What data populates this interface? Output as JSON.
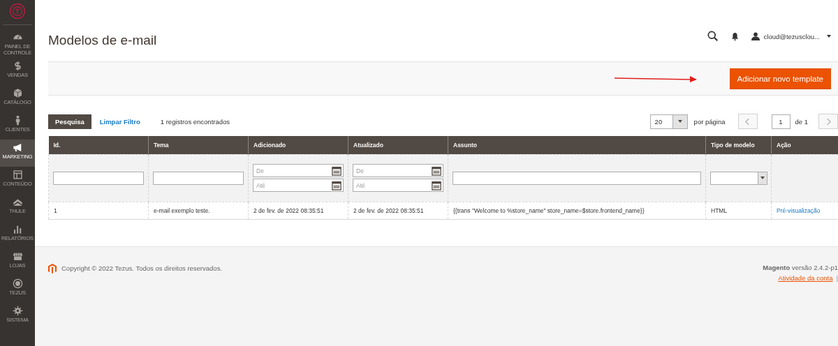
{
  "sidebar": {
    "items": [
      {
        "kind": "dashboard",
        "label": "PAINEL DE CONTROLE",
        "selected": false
      },
      {
        "kind": "dollar",
        "label": "VENDAS",
        "selected": false
      },
      {
        "kind": "box",
        "label": "CATÁLOGO",
        "selected": false
      },
      {
        "kind": "person",
        "label": "CLIENTES",
        "selected": false
      },
      {
        "kind": "megaphone",
        "label": "MARKETING",
        "selected": true
      },
      {
        "kind": "layout",
        "label": "CONTEÚDO",
        "selected": false
      },
      {
        "kind": "chevron",
        "label": "THULE",
        "selected": false
      },
      {
        "kind": "bars",
        "label": "RELATÓRIOS",
        "selected": false
      },
      {
        "kind": "store",
        "label": "LOJAS",
        "selected": false
      },
      {
        "kind": "badge",
        "label": "TEZUS",
        "selected": false
      },
      {
        "kind": "gear",
        "label": "SISTEMA",
        "selected": false
      }
    ]
  },
  "page": {
    "title": "Modelos de e-mail",
    "user": "cloud@tezusclou..."
  },
  "actions": {
    "add_button": "Adicionar novo template"
  },
  "toolbar": {
    "search_button": "Pesquisa",
    "clear_link": "Limpar Filtro",
    "records": "1 registros encontrados",
    "per_page": "20",
    "per_page_label": "por página",
    "page": "1",
    "page_total": "de 1"
  },
  "table": {
    "columns": [
      {
        "label": "Id.",
        "kind": "text"
      },
      {
        "label": "Tema",
        "kind": "text"
      },
      {
        "label": "Adicionado",
        "kind": "date",
        "from": "De",
        "to": "Até"
      },
      {
        "label": "Atualizado",
        "kind": "date",
        "from": "De",
        "to": "Até"
      },
      {
        "label": "Assunto",
        "kind": "text"
      },
      {
        "label": "Tipo de modelo",
        "kind": "select"
      },
      {
        "label": "Ação",
        "kind": "action"
      }
    ],
    "rows": [
      {
        "cells": [
          "1",
          "e-mail exemplo teste.",
          "2 de fev. de 2022 08:35:51",
          "2 de fev. de 2022 08:35:51",
          "{{trans \"Welcome to %store_name\" store_name=$store.frontend_name}}",
          "HTML",
          "Pré-visualização"
        ]
      }
    ]
  },
  "footer": {
    "copyright": "Copyright © 2022 Tezus. Todos os direitos reservados.",
    "version": "**Magento** versão 2.4.2-p1",
    "activity_link": "Atividade da conta",
    "separator": "|"
  }
}
